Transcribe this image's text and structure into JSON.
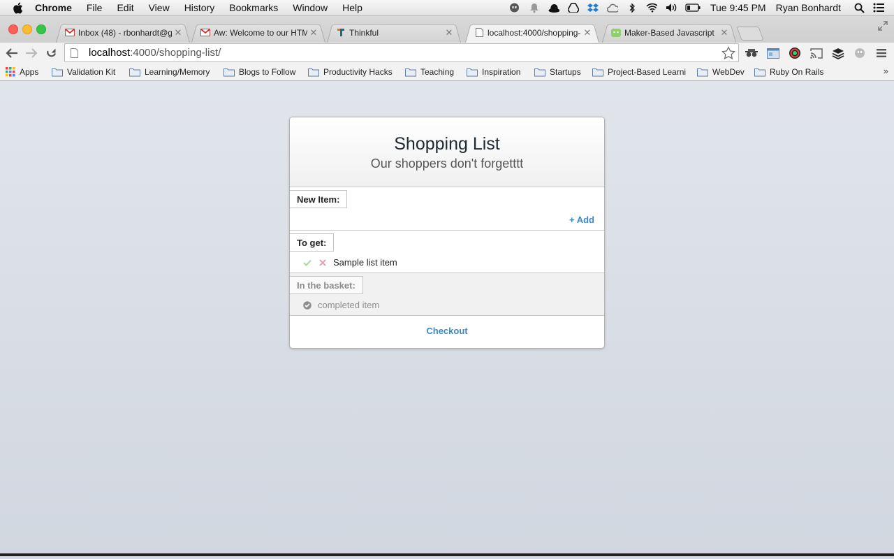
{
  "menubar": {
    "app_name": "Chrome",
    "menus": [
      "File",
      "Edit",
      "View",
      "History",
      "Bookmarks",
      "Window",
      "Help"
    ],
    "clock": "Tue 9:45 PM",
    "user": "Ryan Bonhardt"
  },
  "tabs": [
    {
      "title": "Inbox (48) - rbonhardt@gm",
      "icon": "gmail-icon",
      "active": false
    },
    {
      "title": "Aw: Welcome to our HTML",
      "icon": "gmail-icon",
      "active": false
    },
    {
      "title": "Thinkful",
      "icon": "thinkful-icon",
      "active": false
    },
    {
      "title": "localhost:4000/shopping-l",
      "icon": "page-icon",
      "active": true
    },
    {
      "title": "Maker-Based Javascript",
      "icon": "android-icon",
      "active": false
    }
  ],
  "address_bar": {
    "host": "localhost",
    "path": ":4000/shopping-list/"
  },
  "bookmarks": [
    "Apps",
    "Validation Kit",
    "Learning/Memory",
    "Blogs to Follow",
    "Productivity Hacks",
    "Teaching",
    "Inspiration",
    "Startups",
    "Project-Based Learni",
    "WebDev",
    "Ruby On Rails"
  ],
  "bookmarks_overflow": "»",
  "app": {
    "title": "Shopping List",
    "subtitle": "Our shoppers don't forgetttt",
    "new_item_label": "New Item:",
    "add_label": "+ Add",
    "to_get_label": "To get:",
    "to_get_items": [
      "Sample list item"
    ],
    "basket_label": "In the basket:",
    "basket_items": [
      "completed item"
    ],
    "checkout_label": "Checkout"
  },
  "colors": {
    "accent": "#3a8acb",
    "check_green": "#a8d89a",
    "remove_pink": "#e3a3b2",
    "page_bg": "#d5dbe3"
  }
}
